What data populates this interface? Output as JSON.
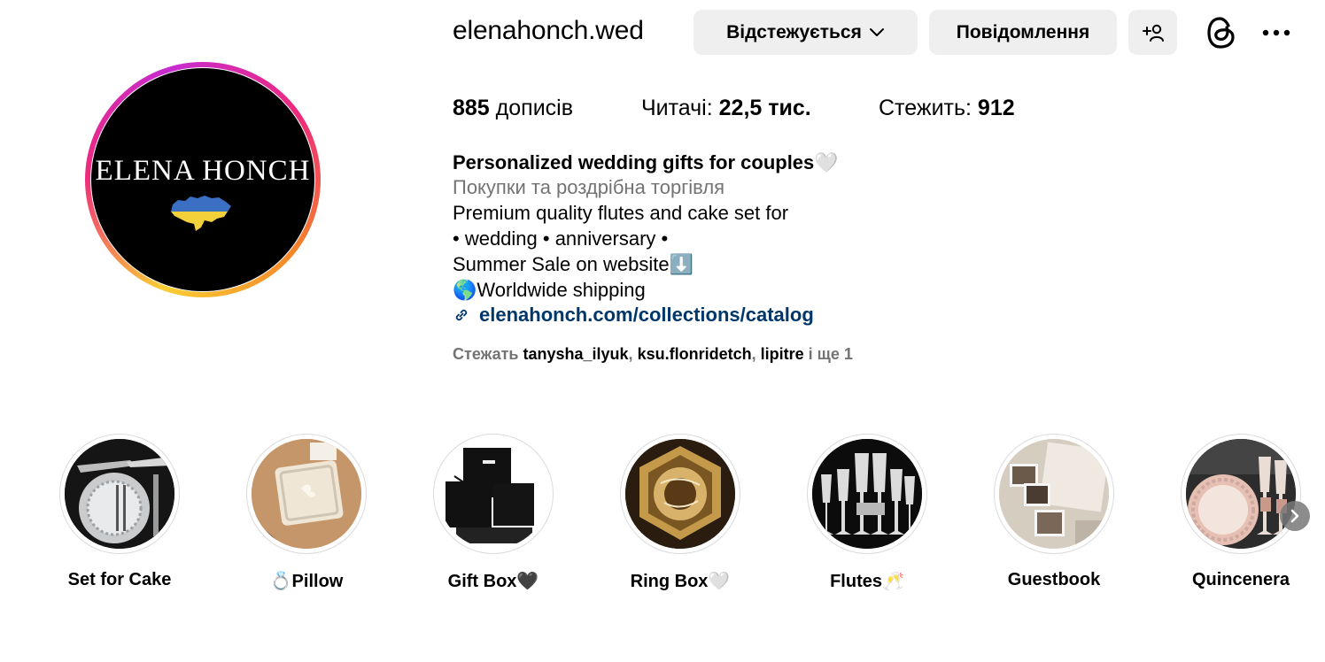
{
  "profile": {
    "username": "elenahonch.wed",
    "avatar_text": "ELENA HONCH",
    "buttons": {
      "following": "Відстежується",
      "message": "Повідомлення"
    },
    "icons": [
      "chevron-down-icon",
      "add-user-icon",
      "threads-icon",
      "more-options-icon",
      "link-icon",
      "chevron-right-icon"
    ]
  },
  "stats": {
    "posts_count": "885",
    "posts_label": "дописів",
    "followers_label": "Читачі:",
    "followers_count": "22,5 тис.",
    "following_label": "Стежить:",
    "following_count": "912"
  },
  "bio": {
    "title": "Personalized wedding gifts for couples🤍",
    "category": "Покупки та роздрібна торгівля",
    "line1": "Premium quality flutes and cake set for",
    "line2": "• wedding • anniversary •",
    "line3": "Summer Sale on website⬇️",
    "line4": "🌎Worldwide shipping",
    "link": "elenahonch.com/collections/catalog"
  },
  "followed_by": {
    "prefix": "Стежать",
    "users": [
      "tanysha_ilyuk",
      "ksu.flonridetch",
      "lipitre"
    ],
    "suffix": "і ще 1"
  },
  "highlights": [
    {
      "label": "Set for Cake"
    },
    {
      "label": "💍Pillow"
    },
    {
      "label": "Gift Box🖤"
    },
    {
      "label": "Ring Box🤍"
    },
    {
      "label": "Flutes🥂"
    },
    {
      "label": "Guestbook"
    },
    {
      "label": "Quincenera"
    }
  ],
  "colors": {
    "button_bg": "#efefef",
    "link": "#00376b",
    "muted": "#737373",
    "ukraine_blue": "#3a6fc4",
    "ukraine_yellow": "#f3d13a"
  }
}
